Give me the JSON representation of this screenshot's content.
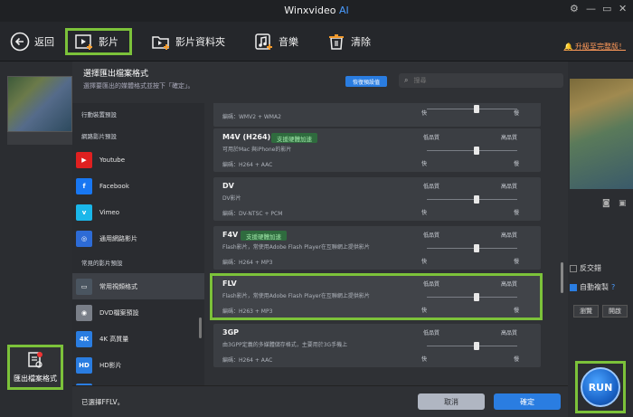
{
  "app": {
    "title": "Winxvideo",
    "title_ai": "AI"
  },
  "toolbar": {
    "back_label": "返回",
    "video_label": "影片",
    "folder_label": "影片資料夾",
    "music_label": "音樂",
    "clear_label": "清除",
    "upgrade_label": "升級至完整版！"
  },
  "left": {
    "export_format_label": "匯出檔案格式"
  },
  "dialog": {
    "title": "選擇匯出檔案格式",
    "subtitle": "選擇要匯出的媒體格式並按下「確定」。",
    "reset_label": "恢復預設值",
    "search_placeholder": "搜尋",
    "categories_top": [
      "行動裝置預設"
    ],
    "categories_heading_web": "網路影片預設",
    "web_items": [
      {
        "label": "Youtube",
        "icon": "youtube-icon",
        "color": "#e02020",
        "glyph": "▶"
      },
      {
        "label": "Facebook",
        "icon": "facebook-icon",
        "color": "#1877f2",
        "glyph": "f"
      },
      {
        "label": "Vimeo",
        "icon": "vimeo-icon",
        "color": "#1ab7ea",
        "glyph": "v"
      },
      {
        "label": "通用網路影片",
        "icon": "globe-icon",
        "color": "#2d6bd6",
        "glyph": "◎"
      }
    ],
    "categories_heading_common": "常見的影片預設",
    "common_items": [
      {
        "label": "常用視頻格式",
        "icon": "monitor-icon",
        "color": "#4a5560",
        "glyph": "▭"
      },
      {
        "label": "DVD檔案預設",
        "icon": "dvd-icon",
        "color": "#7a7f88",
        "glyph": "◉"
      },
      {
        "label": "4K 高質量",
        "icon": "4k-icon",
        "color": "#2a7de1",
        "glyph": "4K"
      },
      {
        "label": "HD影片",
        "icon": "hd-icon",
        "color": "#2a7de1",
        "glyph": "HD"
      },
      {
        "label": "電視機",
        "icon": "tv-icon",
        "color": "#2a7de1",
        "glyph": "TV"
      }
    ],
    "quality": {
      "low": "低品質",
      "high": "高品質",
      "fast": "快",
      "slow": "慢"
    },
    "formats": [
      {
        "name": "",
        "badge": "",
        "desc": "",
        "codec": "編碼：WMV2 + WMA2",
        "quality": 0.55,
        "partial": true
      },
      {
        "name": "M4V (H264)",
        "badge": "支援硬體加速",
        "desc": "可用於Mac 與iPhone的影片",
        "codec": "編碼：H264 + AAC",
        "quality": 0.55
      },
      {
        "name": "DV",
        "badge": "",
        "desc": "DV影片",
        "codec": "編碼：DV-NTSC + PCM",
        "quality": 0.55
      },
      {
        "name": "F4V",
        "badge": "支援硬體加速",
        "desc": "Flash影片，常使用Adobe Flash Player在互聯網上提供影片",
        "codec": "編碼：H264 + MP3",
        "quality": 0.55
      },
      {
        "name": "FLV",
        "badge": "",
        "desc": "Flash影片，常使用Adobe Flash Player在互聯網上提供影片",
        "codec": "編碼：H263 + MP3",
        "quality": 0.55
      },
      {
        "name": "3GP",
        "badge": "",
        "desc": "由3GPP定義的多媒體儲存格式，主要用於3G手機上",
        "codec": "編碼：H264 + AAC",
        "quality": 0.55
      }
    ],
    "chosen_label": "已選擇FFLV。",
    "cancel_label": "取消",
    "ok_label": "確定"
  },
  "right": {
    "deinterlace_label": "反交錯",
    "autocopy_label": "自動複製",
    "help_label": "?",
    "browse_label": "瀏覽",
    "open_label": "開啟",
    "run_label": "RUN"
  }
}
